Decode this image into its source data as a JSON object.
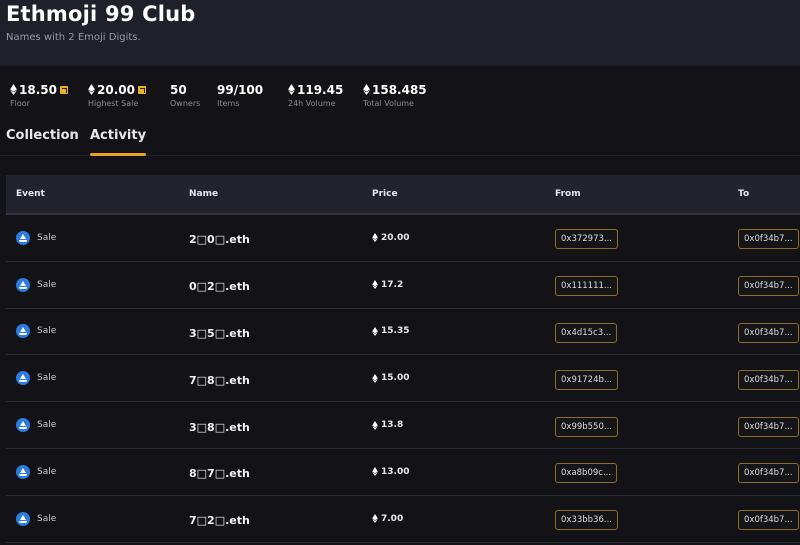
{
  "collection": {
    "title": "Ethmoji 99 Club",
    "subtitle": "Names with 2 Emoji Digits."
  },
  "stats": [
    {
      "value": "18.50",
      "label": "Floor",
      "eth": true,
      "external_link": true
    },
    {
      "value": "20.00",
      "label": "Highest Sale",
      "eth": true,
      "external_link": true
    },
    {
      "value": "50",
      "label": "Owners",
      "eth": false,
      "external_link": false
    },
    {
      "value": "99/100",
      "label": "Items",
      "eth": false,
      "external_link": false
    },
    {
      "value": "119.45",
      "label": "24h Volume",
      "eth": true,
      "external_link": false
    },
    {
      "value": "158.485",
      "label": "Total Volume",
      "eth": true,
      "external_link": false
    }
  ],
  "tabs": [
    {
      "label": "Collection",
      "active": false
    },
    {
      "label": "Activity",
      "active": true
    }
  ],
  "colors": {
    "accent": "#e8a32a",
    "event_icon": "#2b7be0",
    "address_border": "#8a6e2e"
  },
  "table": {
    "headers": [
      "Event",
      "Name",
      "Price",
      "From",
      "To"
    ],
    "rows": [
      {
        "event": "Sale",
        "name": "2□0□.eth",
        "price": "20.00",
        "from": "0x372973...",
        "to": "0x0f34b7..."
      },
      {
        "event": "Sale",
        "name": "0□2□.eth",
        "price": "17.2",
        "from": "0x111111...",
        "to": "0x0f34b7..."
      },
      {
        "event": "Sale",
        "name": "3□5□.eth",
        "price": "15.35",
        "from": "0x4d15c3...",
        "to": "0x0f34b7..."
      },
      {
        "event": "Sale",
        "name": "7□8□.eth",
        "price": "15.00",
        "from": "0x91724b...",
        "to": "0x0f34b7..."
      },
      {
        "event": "Sale",
        "name": "3□8□.eth",
        "price": "13.8",
        "from": "0x99b550...",
        "to": "0x0f34b7..."
      },
      {
        "event": "Sale",
        "name": "8□7□.eth",
        "price": "13.00",
        "from": "0xa8b09c...",
        "to": "0x0f34b7..."
      },
      {
        "event": "Sale",
        "name": "7□2□.eth",
        "price": "7.00",
        "from": "0x33bb36...",
        "to": "0x0f34b7..."
      }
    ]
  }
}
